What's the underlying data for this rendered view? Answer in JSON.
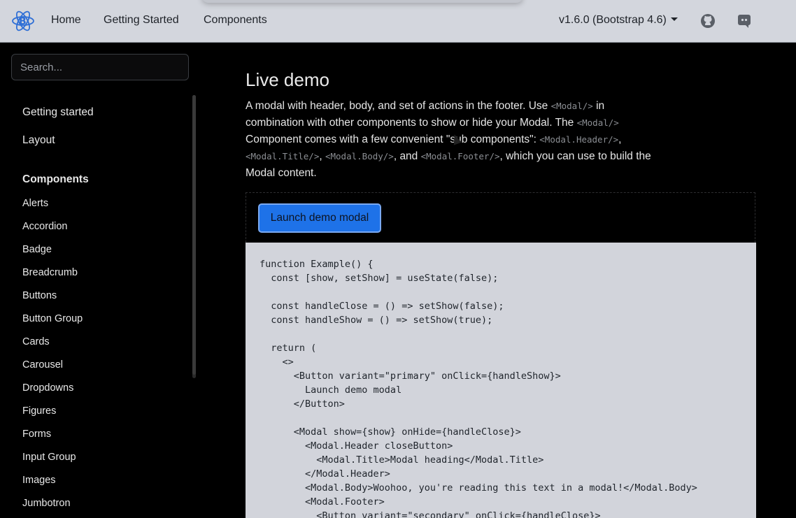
{
  "navbar": {
    "brand_icon": "react-bootstrap-logo",
    "links": [
      "Home",
      "Getting Started",
      "Components"
    ],
    "version": "v1.6.0 (Bootstrap 4.6)",
    "icons": [
      "github-icon",
      "discord-icon"
    ]
  },
  "sidebar": {
    "search_placeholder": "Search...",
    "top_items": [
      "Getting started",
      "Layout"
    ],
    "components_heading": "Components",
    "components": [
      "Alerts",
      "Accordion",
      "Badge",
      "Breadcrumb",
      "Buttons",
      "Button Group",
      "Cards",
      "Carousel",
      "Dropdowns",
      "Figures",
      "Forms",
      "Input Group",
      "Images",
      "Jumbotron"
    ]
  },
  "main": {
    "title": "Live demo",
    "desc": {
      "p1": "A modal with header, body, and set of actions in the footer. Use ",
      "c1": "<Modal/>",
      "p2": " in combination with other components to show or hide your Modal. The ",
      "c2": "<Modal/>",
      "p3": " Component comes with a few convenient \"sub components\": ",
      "c3": "<Modal.Header/>",
      "p4": ", ",
      "c4": "<Modal.Title/>",
      "p5": ", ",
      "c5": "<Modal.Body/>",
      "p6": ", and ",
      "c6": "<Modal.Footer/>",
      "p7": ", which you can use to build the Modal content."
    },
    "demo_button": "Launch demo modal",
    "code": "function Example() {\n  const [show, setShow] = useState(false);\n\n  const handleClose = () => setShow(false);\n  const handleShow = () => setShow(true);\n\n  return (\n    <>\n      <Button variant=\"primary\" onClick={handleShow}>\n        Launch demo modal\n      </Button>\n\n      <Modal show={show} onHide={handleClose}>\n        <Modal.Header closeButton>\n          <Modal.Title>Modal heading</Modal.Title>\n        </Modal.Header>\n        <Modal.Body>Woohoo, you're reading this text in a modal!</Modal.Body>\n        <Modal.Footer>\n          <Button variant=\"secondary\" onClick={handleClose}>"
  }
}
